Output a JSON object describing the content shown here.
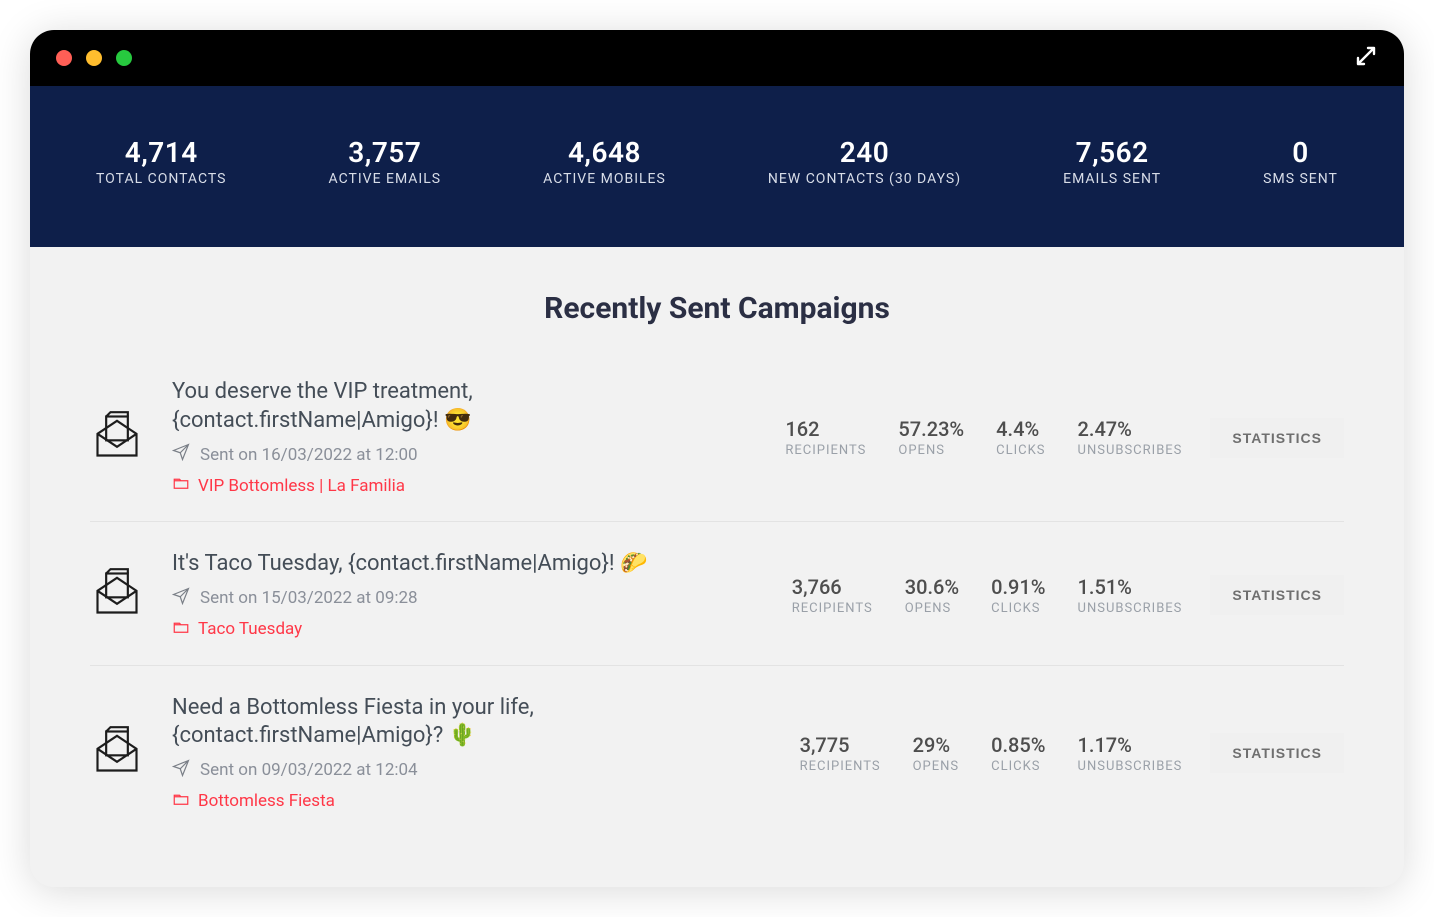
{
  "window": {
    "fullscreen_icon": "expand-icon"
  },
  "stats": [
    {
      "value": "4,714",
      "label": "TOTAL CONTACTS"
    },
    {
      "value": "3,757",
      "label": "ACTIVE EMAILS"
    },
    {
      "value": "4,648",
      "label": "ACTIVE MOBILES"
    },
    {
      "value": "240",
      "label": "NEW CONTACTS (30 DAYS)"
    },
    {
      "value": "7,562",
      "label": "EMAILS SENT"
    },
    {
      "value": "0",
      "label": "SMS SENT"
    }
  ],
  "section_title": "Recently Sent Campaigns",
  "metric_labels": {
    "recipients": "RECIPIENTS",
    "opens": "OPENS",
    "clicks": "CLICKS",
    "unsubs": "UNSUBSCRIBES"
  },
  "stats_button": "STATISTICS",
  "campaigns": [
    {
      "subject": "You deserve the VIP treatment, {contact.firstName|Amigo}! 😎",
      "sent_text": "Sent on 16/03/2022 at 12:00",
      "tag": "VIP Bottomless | La Familia",
      "recipients": "162",
      "opens": "57.23%",
      "clicks": "4.4%",
      "unsubs": "2.47%"
    },
    {
      "subject": "It's Taco Tuesday, {contact.firstName|Amigo}! 🌮",
      "sent_text": "Sent on 15/03/2022 at 09:28",
      "tag": "Taco Tuesday",
      "recipients": "3,766",
      "opens": "30.6%",
      "clicks": "0.91%",
      "unsubs": "1.51%"
    },
    {
      "subject": "Need a Bottomless Fiesta in your life, {contact.firstName|Amigo}? 🌵",
      "sent_text": "Sent on 09/03/2022 at 12:04",
      "tag": "Bottomless Fiesta",
      "recipients": "3,775",
      "opens": "29%",
      "clicks": "0.85%",
      "unsubs": "1.17%"
    }
  ]
}
